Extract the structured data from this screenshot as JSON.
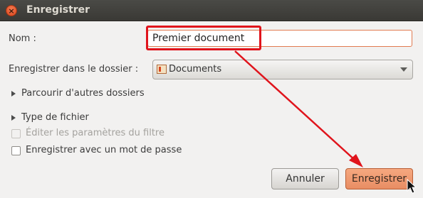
{
  "window": {
    "title": "Enregistrer",
    "close_glyph": "×"
  },
  "form": {
    "name_label": "Nom :",
    "name_value": "Premier document",
    "folder_label": "Enregistrer dans le dossier :",
    "folder_value": "Documents",
    "browse_label": "Parcourir d'autres dossiers",
    "filetype_label": "Type de fichier",
    "filter_label": "Éditer les paramètres du filtre",
    "filter_checked": false,
    "filter_enabled": false,
    "password_label": "Enregistrer avec un mot de passe",
    "password_checked": false
  },
  "buttons": {
    "cancel": "Annuler",
    "save": "Enregistrer"
  },
  "colors": {
    "annotation": "#e0141c",
    "accent": "#e88d63",
    "titlebar": "#3c3b37"
  }
}
